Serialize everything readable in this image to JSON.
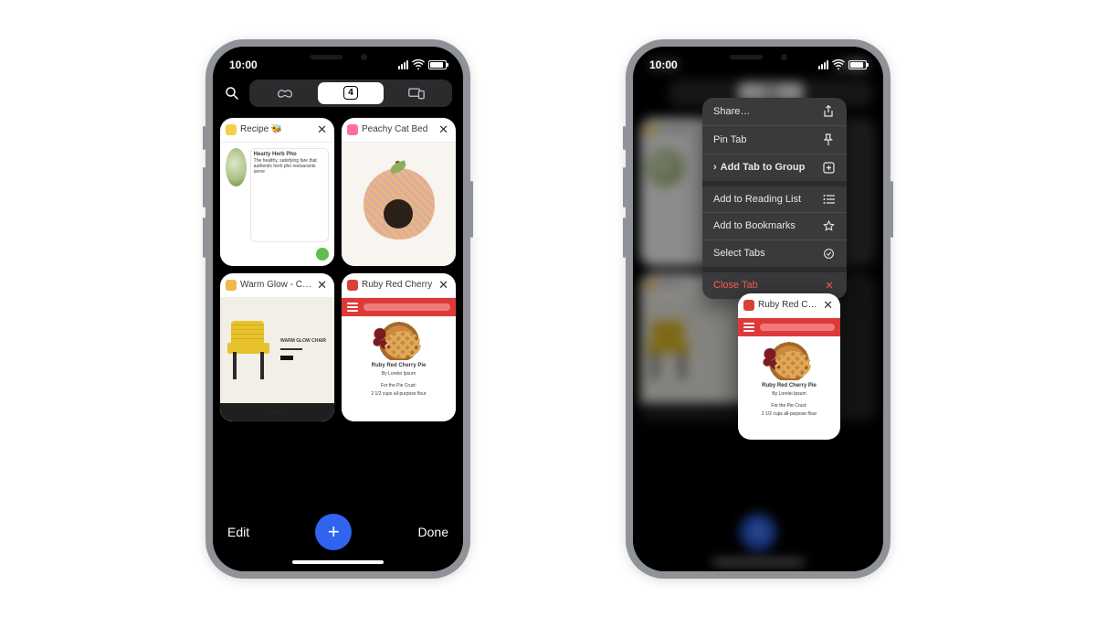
{
  "status": {
    "time": "10:00"
  },
  "segmented": {
    "tab_count": "4"
  },
  "tabs": [
    {
      "title": "Recipe 🐝",
      "thumb_h1": "Hearty Herb Pho",
      "thumb_sub": "The healthy, satisfying fare that authentic herb pho restaurants serve"
    },
    {
      "title": "Peachy Cat Bed"
    },
    {
      "title": "Warm Glow - Cha",
      "thumb_h1": "WARM GLOW CHAIR"
    },
    {
      "title": "Ruby Red Cherry",
      "thumb_h1": "Ruby Red Cherry Pie",
      "thumb_sub": "By Lorelei Ipsum",
      "thumb_l1": "For the Pie Crust:",
      "thumb_l2": "2 1/2 cups all-purpose flour"
    }
  ],
  "bottom": {
    "edit": "Edit",
    "done": "Done"
  },
  "context_menu": {
    "share": "Share…",
    "pin": "Pin Tab",
    "group": "Add Tab to Group",
    "reading": "Add to Reading List",
    "bookmark": "Add to Bookmarks",
    "select": "Select Tabs",
    "close": "Close Tab"
  },
  "context_tab": {
    "title": "Ruby Red Cherry"
  }
}
